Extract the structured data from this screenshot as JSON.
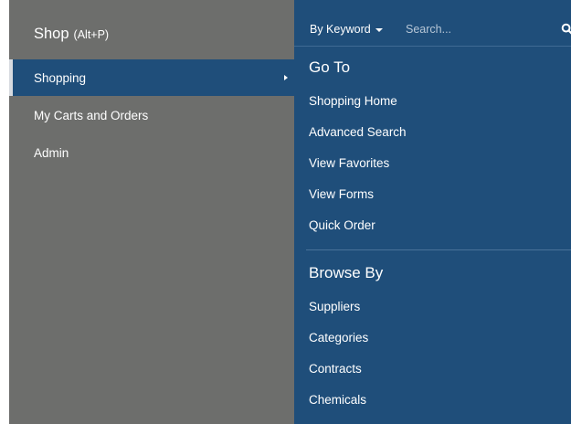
{
  "left_panel": {
    "title": "Shop",
    "shortcut": "(Alt+P)",
    "items": [
      {
        "label": "Shopping",
        "active": true
      },
      {
        "label": "My Carts and Orders",
        "active": false
      },
      {
        "label": "Admin",
        "active": false
      }
    ]
  },
  "search": {
    "mode_label": "By Keyword",
    "placeholder": "Search..."
  },
  "goto": {
    "heading": "Go To",
    "links": [
      "Shopping Home",
      "Advanced Search",
      "View Favorites",
      "View Forms",
      "Quick Order"
    ]
  },
  "browse": {
    "heading": "Browse By",
    "links": [
      "Suppliers",
      "Categories",
      "Contracts",
      "Chemicals"
    ]
  },
  "colors": {
    "left_panel_bg": "#6d6e6c",
    "active_item_bg": "#1f4e7a",
    "right_panel_bg": "#1f4e7a",
    "text": "#ffffff"
  },
  "icons": {
    "search": "search-icon",
    "submenu_arrow": "chevron-right-icon",
    "dropdown": "caret-down-icon"
  }
}
